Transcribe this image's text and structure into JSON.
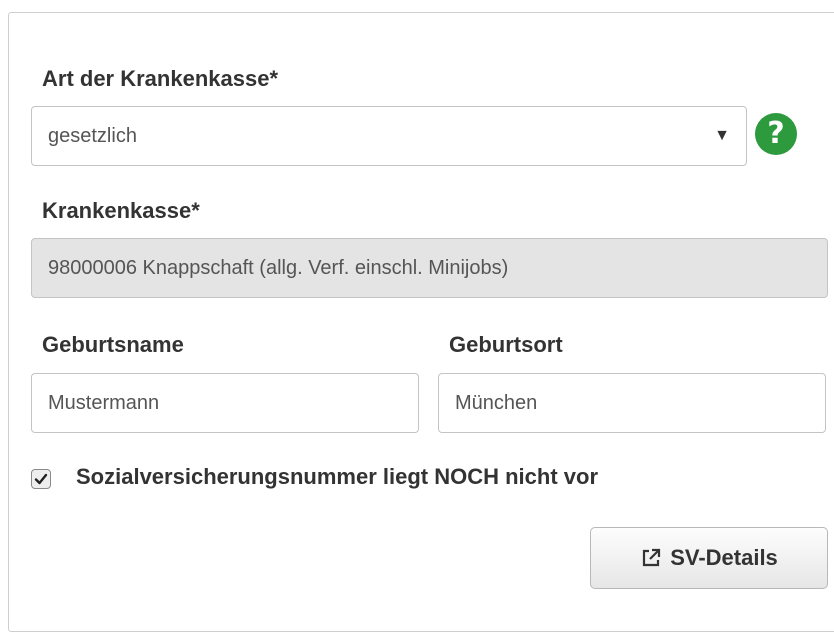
{
  "insurance_type": {
    "label": "Art der Krankenkasse*",
    "selected": "gesetzlich",
    "help_icon": "question-circle-icon"
  },
  "insurer": {
    "label": "Krankenkasse*",
    "value": "98000006 Knappschaft (allg. Verf. einschl. Minijobs)"
  },
  "birth_name": {
    "label": "Geburtsname",
    "value": "Mustermann"
  },
  "birth_place": {
    "label": "Geburtsort",
    "value": "München"
  },
  "sv_pending": {
    "label": "Sozialversicherungsnummer liegt NOCH nicht vor",
    "checked": true
  },
  "sv_details_button": {
    "label": "SV-Details",
    "icon": "external-link-icon"
  },
  "colors": {
    "help_green": "#2e9a3e",
    "readonly_bg": "#e4e4e4"
  }
}
